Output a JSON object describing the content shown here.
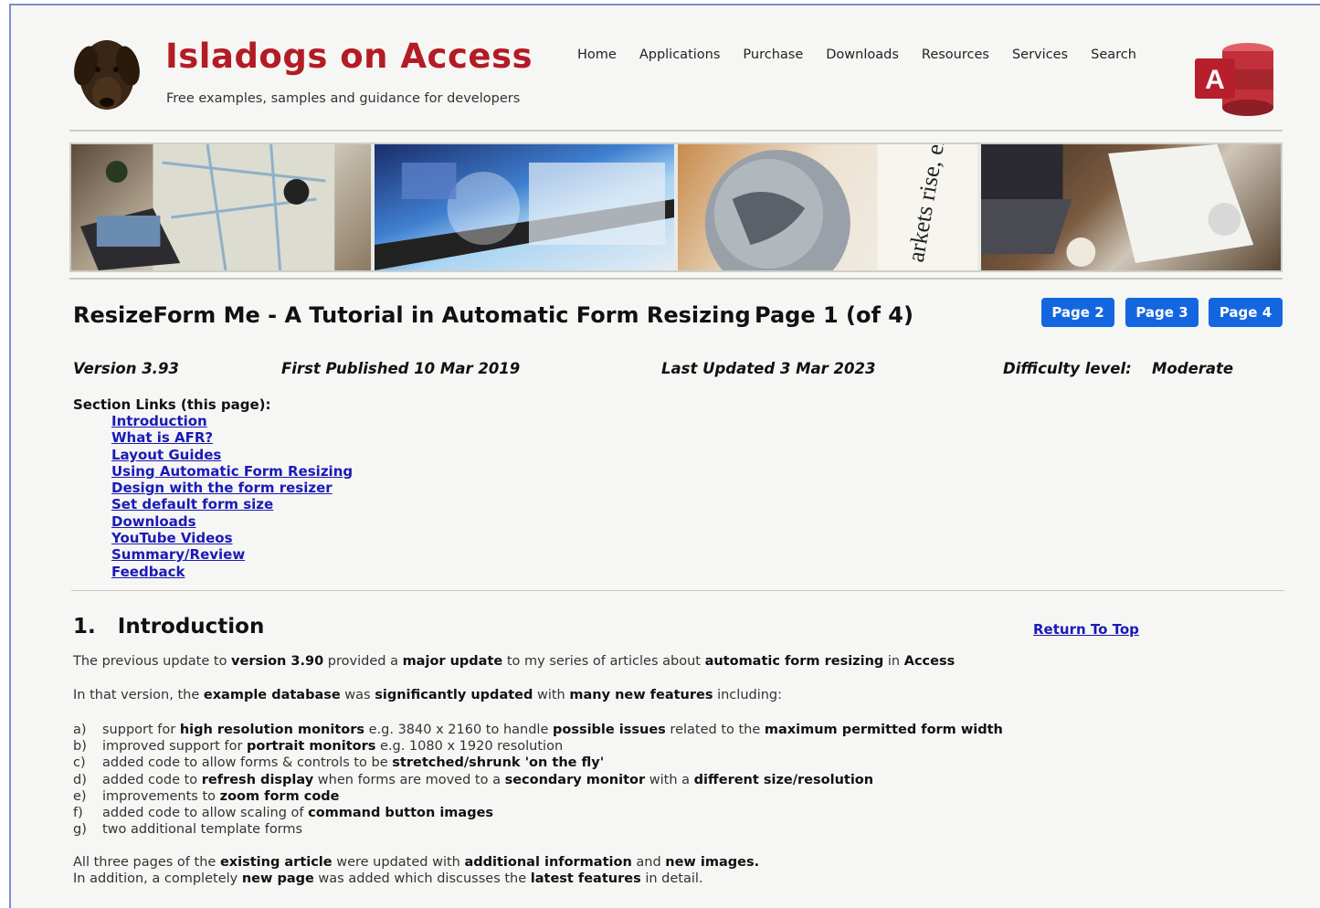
{
  "header": {
    "site_title": "Isladogs on Access",
    "tagline": "Free examples, samples and guidance for developers",
    "nav": [
      "Home",
      "Applications",
      "Purchase",
      "Downloads",
      "Resources",
      "Services",
      "Search"
    ],
    "access_logo_letter": "A"
  },
  "banner": {
    "pane_text": "arkets rise, exp"
  },
  "article": {
    "title": "ResizeForm Me - A Tutorial in Automatic Form Resizing",
    "page_indicator": "Page 1 (of 4)",
    "page_buttons": [
      "Page 2",
      "Page 3",
      "Page 4"
    ],
    "version": "Version 3.93",
    "first_published": "First Published 10 Mar 2019",
    "last_updated": "Last Updated 3 Mar 2023",
    "difficulty_label": "Difficulty level:",
    "difficulty_value": "Moderate"
  },
  "section_links": {
    "label": "Section Links (this page):",
    "items": [
      "Introduction",
      "What is AFR?",
      "Layout Guides",
      "Using Automatic Form Resizing",
      "Design with the form resizer",
      "Set default form size",
      "Downloads",
      "YouTube Videos",
      "Summary/Review",
      "Feedback"
    ]
  },
  "intro": {
    "heading": "1.   Introduction",
    "return_top": "Return To Top",
    "p1": [
      {
        "t": "The previous update to ",
        "b": false
      },
      {
        "t": "version 3.90",
        "b": true
      },
      {
        "t": " provided a ",
        "b": false
      },
      {
        "t": "major update",
        "b": true
      },
      {
        "t": " to my series of articles about ",
        "b": false
      },
      {
        "t": "automatic form resizing",
        "b": true
      },
      {
        "t": " in ",
        "b": false
      },
      {
        "t": "Access",
        "b": true
      }
    ],
    "p2": [
      {
        "t": "In that version, the ",
        "b": false
      },
      {
        "t": "example database",
        "b": true
      },
      {
        "t": " was ",
        "b": false
      },
      {
        "t": "significantly updated",
        "b": true
      },
      {
        "t": " with ",
        "b": false
      },
      {
        "t": "many new features",
        "b": true
      },
      {
        "t": " including:",
        "b": false
      }
    ],
    "list": [
      {
        "k": "a)",
        "parts": [
          {
            "t": "support for ",
            "b": false
          },
          {
            "t": "high resolution monitors",
            "b": true
          },
          {
            "t": " e.g. 3840 x 2160 to handle ",
            "b": false
          },
          {
            "t": "possible issues",
            "b": true
          },
          {
            "t": " related to the ",
            "b": false
          },
          {
            "t": "maximum permitted form width",
            "b": true
          }
        ]
      },
      {
        "k": "b)",
        "parts": [
          {
            "t": "improved support for ",
            "b": false
          },
          {
            "t": "portrait monitors",
            "b": true
          },
          {
            "t": " e.g. 1080 x 1920 resolution",
            "b": false
          }
        ]
      },
      {
        "k": "c)",
        "parts": [
          {
            "t": "added code to allow forms & controls to be ",
            "b": false
          },
          {
            "t": "stretched/shrunk 'on the fly'",
            "b": true
          }
        ]
      },
      {
        "k": "d)",
        "parts": [
          {
            "t": "added code to ",
            "b": false
          },
          {
            "t": "refresh display",
            "b": true
          },
          {
            "t": " when forms are moved to a ",
            "b": false
          },
          {
            "t": "secondary monitor",
            "b": true
          },
          {
            "t": " with a ",
            "b": false
          },
          {
            "t": "different size/resolution",
            "b": true
          }
        ]
      },
      {
        "k": "e)",
        "parts": [
          {
            "t": "improvements to ",
            "b": false
          },
          {
            "t": "zoom form code",
            "b": true
          }
        ]
      },
      {
        "k": "f)",
        "parts": [
          {
            "t": "added code to allow scaling of ",
            "b": false
          },
          {
            "t": "command button images",
            "b": true
          }
        ]
      },
      {
        "k": "g)",
        "parts": [
          {
            "t": "two additional template forms",
            "b": false
          }
        ]
      }
    ],
    "p3": [
      {
        "t": "All three pages of the ",
        "b": false
      },
      {
        "t": "existing article",
        "b": true
      },
      {
        "t": " were updated with ",
        "b": false
      },
      {
        "t": "additional information",
        "b": true
      },
      {
        "t": " and ",
        "b": false
      },
      {
        "t": "new images.",
        "b": true
      }
    ],
    "p4": [
      {
        "t": "In addition, a completely ",
        "b": false
      },
      {
        "t": "new page",
        "b": true
      },
      {
        "t": " was added which discusses the ",
        "b": false
      },
      {
        "t": "latest features",
        "b": true
      },
      {
        "t": " in detail.",
        "b": false
      }
    ]
  },
  "colors": {
    "title_red": "#b31b25",
    "link_blue": "#1a1ab8",
    "button_blue": "#1466e0",
    "background": "#f6f6f4"
  }
}
